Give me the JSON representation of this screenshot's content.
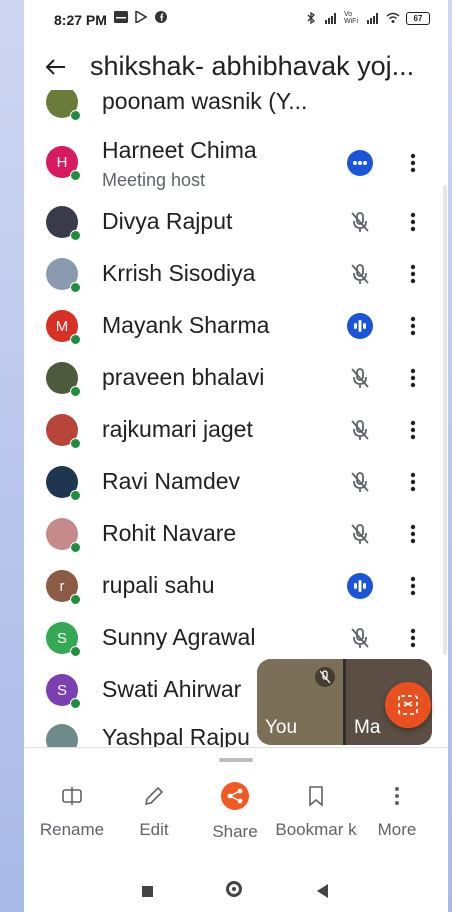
{
  "status_bar": {
    "time": "8:27 PM",
    "battery": "67",
    "network_label": "Vo WiFi",
    "left_icons": [
      "gallery-icon",
      "play-store-icon",
      "facebook-icon"
    ],
    "right_icons": [
      "bluetooth-icon",
      "signal-icon",
      "vowifi-icon",
      "signal-icon",
      "wifi-icon",
      "battery-icon"
    ]
  },
  "header": {
    "title": "shikshak- abhibhavak yoj...",
    "back_icon": "arrow-back-icon"
  },
  "participants": [
    {
      "name": "poonam wasnik (Y...",
      "avatar": {
        "type": "photo",
        "color": "#6b7b3a"
      },
      "status": "none"
    },
    {
      "name": "Harneet Chima",
      "subtitle": "Meeting host",
      "avatar": {
        "type": "initial",
        "letter": "H",
        "color": "#d81b60"
      },
      "status": "more"
    },
    {
      "name": "Divya Rajput",
      "avatar": {
        "type": "photo",
        "color": "#3a3a4a"
      },
      "status": "muted"
    },
    {
      "name": "Krrish Sisodiya",
      "avatar": {
        "type": "photo",
        "color": "#8a9bb0"
      },
      "status": "muted"
    },
    {
      "name": "Mayank Sharma",
      "avatar": {
        "type": "initial",
        "letter": "M",
        "color": "#d93025"
      },
      "status": "speaking"
    },
    {
      "name": "praveen bhalavi",
      "avatar": {
        "type": "photo",
        "color": "#4d5a3e"
      },
      "status": "muted"
    },
    {
      "name": "rajkumari jaget",
      "avatar": {
        "type": "photo",
        "color": "#b8453a"
      },
      "status": "muted"
    },
    {
      "name": "Ravi Namdev",
      "avatar": {
        "type": "photo",
        "color": "#1f3550"
      },
      "status": "muted"
    },
    {
      "name": "Rohit Navare",
      "avatar": {
        "type": "photo",
        "color": "#c78a8a"
      },
      "status": "muted"
    },
    {
      "name": "rupali sahu",
      "avatar": {
        "type": "initial",
        "letter": "r",
        "color": "#8d5a45"
      },
      "status": "speaking"
    },
    {
      "name": "Sunny Agrawal",
      "avatar": {
        "type": "initial",
        "letter": "S",
        "color": "#34a853"
      },
      "status": "muted"
    },
    {
      "name": "Swati Ahirwar",
      "avatar": {
        "type": "initial",
        "letter": "S",
        "color": "#7b3fb3"
      },
      "status": "none"
    },
    {
      "name": "Yashpal Rajpu",
      "avatar": {
        "type": "photo",
        "color": "#6f8a8a"
      },
      "status": "none"
    }
  ],
  "pip": {
    "tiles": [
      {
        "label": "You",
        "muted": true
      },
      {
        "label": "Ma",
        "speaking": true
      }
    ]
  },
  "bottom_sheet": {
    "actions": [
      {
        "label": "Rename",
        "icon": "rename-icon"
      },
      {
        "label": "Edit",
        "icon": "pencil-icon"
      },
      {
        "label": "Share",
        "icon": "share-icon"
      },
      {
        "label": "Bookmar k",
        "icon": "bookmark-icon"
      },
      {
        "label": "More",
        "icon": "more-vert-icon"
      }
    ]
  },
  "colors": {
    "accent_blue": "#1a54d9",
    "online_green": "#1e8e3e",
    "share_orange": "#f05a22",
    "capture_orange": "#e8501f"
  }
}
